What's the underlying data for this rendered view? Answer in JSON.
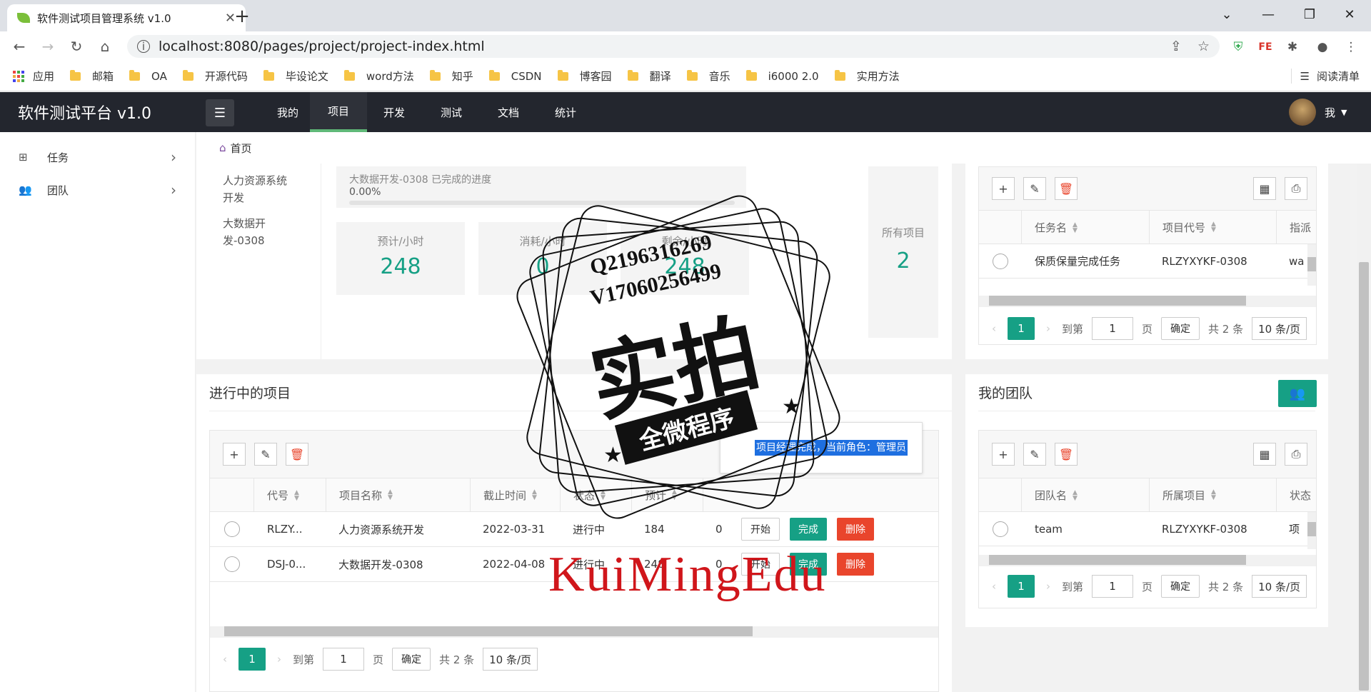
{
  "browser": {
    "tab_title": "软件测试项目管理系统 v1.0",
    "tab_close": "✕",
    "new_tab": "+",
    "url": "localhost:8080/pages/project/project-index.html",
    "bookmarks": [
      "应用",
      "邮箱",
      "OA",
      "开源代码",
      "毕设论文",
      "word方法",
      "知乎",
      "CSDN",
      "博客园",
      "翻译",
      "音乐",
      "i6000 2.0",
      "实用方法"
    ],
    "reading_list": "阅读清单"
  },
  "app": {
    "brand": "软件测试平台 v1.0",
    "nav": [
      "我的",
      "项目",
      "开发",
      "测试",
      "文档",
      "统计"
    ],
    "active_nav": "项目",
    "user_label": "我"
  },
  "sidebar": {
    "items": [
      {
        "label": "任务"
      },
      {
        "label": "团队"
      }
    ]
  },
  "breadcrumb": {
    "home": "首页"
  },
  "overview": {
    "projects": [
      "人力资源系统开发",
      "大数据开发-0308"
    ],
    "progress_label": "大数据开发-0308 已完成的进度",
    "progress_value": "0.00%",
    "progress_fraction": 0.0,
    "stats": [
      {
        "label": "预计/小时",
        "value": "248"
      },
      {
        "label": "消耗/小时",
        "value": "0"
      },
      {
        "label": "剩余/小时",
        "value": "248"
      }
    ],
    "all_projects_label": "所有项目",
    "all_projects_value": "2"
  },
  "tasks_table": {
    "columns": [
      "任务名",
      "项目代号",
      "指派"
    ],
    "rows": [
      {
        "name": "保质保量完成任务",
        "code": "RLZYXYKF-0308",
        "assign": "wa"
      }
    ],
    "pager": {
      "page": "1",
      "goto": "到第",
      "page_input": "1",
      "page_unit": "页",
      "confirm": "确定",
      "total": "共 2 条",
      "per_page": "10 条/页"
    }
  },
  "projects_section": {
    "title": "进行中的项目",
    "columns": [
      "代号",
      "项目名称",
      "截止时间",
      "状态",
      "预计"
    ],
    "rows": [
      {
        "code": "RLZY...",
        "name": "人力资源系统开发",
        "deadline": "2022-03-31",
        "status": "进行中",
        "estimate": "184",
        "extra": "0"
      },
      {
        "code": "DSJ-0...",
        "name": "大数据开发-0308",
        "deadline": "2022-04-08",
        "status": "进行中",
        "estimate": "248",
        "extra": "0"
      }
    ],
    "actions": {
      "start": "开始",
      "finish": "完成",
      "delete": "删除"
    },
    "tooltip": "项目经理完成，当前角色：管理员",
    "pager": {
      "page": "1",
      "goto": "到第",
      "page_input": "1",
      "page_unit": "页",
      "confirm": "确定",
      "total": "共 2 条",
      "per_page": "10 条/页"
    }
  },
  "team_section": {
    "title": "我的团队",
    "columns": [
      "团队名",
      "所属项目",
      "状态"
    ],
    "rows": [
      {
        "name": "team",
        "project": "RLZYXYKF-0308",
        "status": "项"
      }
    ],
    "pager": {
      "page": "1",
      "goto": "到第",
      "page_input": "1",
      "page_unit": "页",
      "confirm": "确定",
      "total": "共 2 条",
      "per_page": "10 条/页"
    }
  },
  "watermark": {
    "line1": "Q2196316269",
    "line2": "V17060256499",
    "big": "实拍",
    "ribbon": "全微程序",
    "footer": "KuiMingEdu"
  }
}
